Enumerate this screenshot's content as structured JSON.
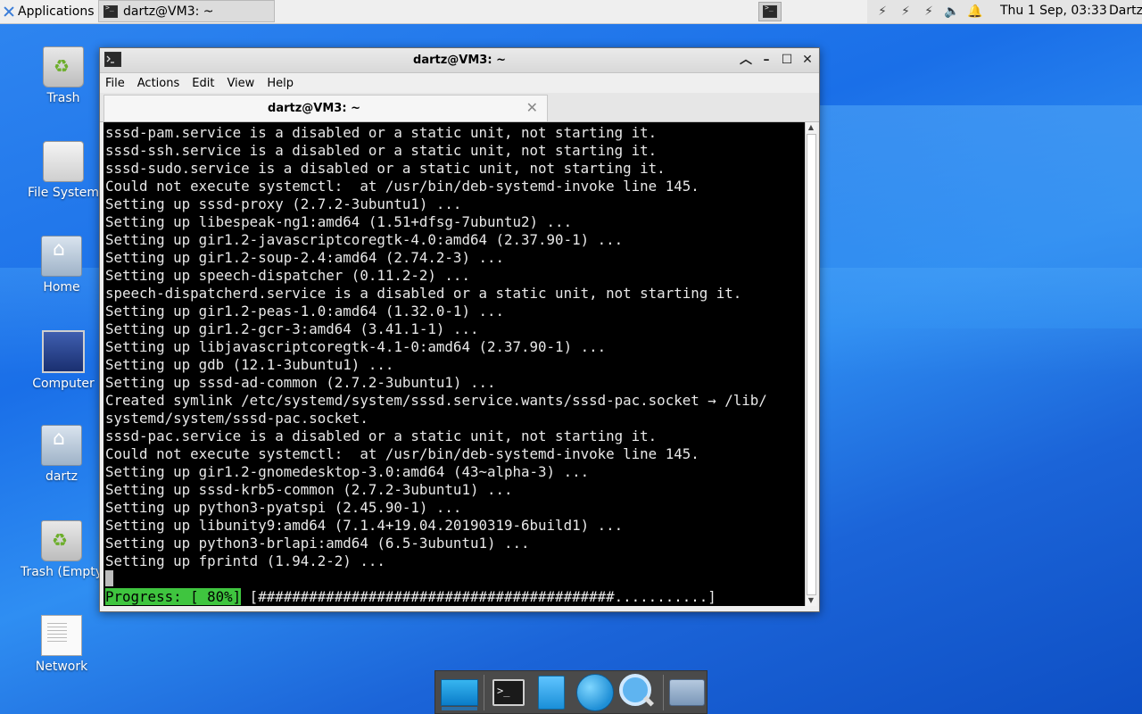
{
  "top_panel": {
    "applications_label": "Applications",
    "task_title": "dartz@VM3: ~",
    "clock": "Thu  1 Sep, 03:33",
    "user": "Dartz"
  },
  "desktop_icons": [
    {
      "name": "trash",
      "label": "Trash",
      "icon": "trash-icon"
    },
    {
      "name": "file-system",
      "label": "File System",
      "icon": "drive-icon"
    },
    {
      "name": "home",
      "label": "Home",
      "icon": "home-folder-icon"
    },
    {
      "name": "computer",
      "label": "Computer",
      "icon": "computer-icon"
    },
    {
      "name": "dartz",
      "label": "dartz",
      "icon": "home-folder-icon"
    },
    {
      "name": "trash-empty",
      "label": "Trash (Empty",
      "icon": "trash-icon"
    },
    {
      "name": "network",
      "label": "Network",
      "icon": "document-icon"
    }
  ],
  "window": {
    "title": "dartz@VM3: ~",
    "menu": [
      "File",
      "Actions",
      "Edit",
      "View",
      "Help"
    ],
    "tab_title": "dartz@VM3: ~"
  },
  "terminal": {
    "lines": [
      "sssd-pam.service is a disabled or a static unit, not starting it.",
      "sssd-ssh.service is a disabled or a static unit, not starting it.",
      "sssd-sudo.service is a disabled or a static unit, not starting it.",
      "Could not execute systemctl:  at /usr/bin/deb-systemd-invoke line 145.",
      "Setting up sssd-proxy (2.7.2-3ubuntu1) ...",
      "Setting up libespeak-ng1:amd64 (1.51+dfsg-7ubuntu2) ...",
      "Setting up gir1.2-javascriptcoregtk-4.0:amd64 (2.37.90-1) ...",
      "Setting up gir1.2-soup-2.4:amd64 (2.74.2-3) ...",
      "Setting up speech-dispatcher (0.11.2-2) ...",
      "speech-dispatcherd.service is a disabled or a static unit, not starting it.",
      "Setting up gir1.2-peas-1.0:amd64 (1.32.0-1) ...",
      "Setting up gir1.2-gcr-3:amd64 (3.41.1-1) ...",
      "Setting up libjavascriptcoregtk-4.1-0:amd64 (2.37.90-1) ...",
      "Setting up gdb (12.1-3ubuntu1) ...",
      "Setting up sssd-ad-common (2.7.2-3ubuntu1) ...",
      "Created symlink /etc/systemd/system/sssd.service.wants/sssd-pac.socket → /lib/",
      "systemd/system/sssd-pac.socket.",
      "sssd-pac.service is a disabled or a static unit, not starting it.",
      "Could not execute systemctl:  at /usr/bin/deb-systemd-invoke line 145.",
      "Setting up gir1.2-gnomedesktop-3.0:amd64 (43~alpha-3) ...",
      "Setting up sssd-krb5-common (2.7.2-3ubuntu1) ...",
      "Setting up python3-pyatspi (2.45.90-1) ...",
      "Setting up libunity9:amd64 (7.1.4+19.04.20190319-6build1) ...",
      "Setting up python3-brlapi:amd64 (6.5-3ubuntu1) ...",
      "Setting up fprintd (1.94.2-2) ..."
    ],
    "progress_label": "Progress: [ 80%]",
    "progress_bar": " [##########################################...........]",
    "progress_percent": 80
  },
  "dock": [
    {
      "name": "show-desktop",
      "icon": "desktop-icon"
    },
    {
      "name": "terminal",
      "icon": "terminal-icon"
    },
    {
      "name": "file-manager",
      "icon": "files-icon"
    },
    {
      "name": "web-browser",
      "icon": "globe-icon"
    },
    {
      "name": "app-finder",
      "icon": "magnifier-icon"
    },
    {
      "name": "folder",
      "icon": "folder-icon"
    }
  ],
  "colors": {
    "progress_green": "#3fc53f",
    "terminal_bg": "#000000",
    "desktop_blue": "#1a6fe8"
  }
}
